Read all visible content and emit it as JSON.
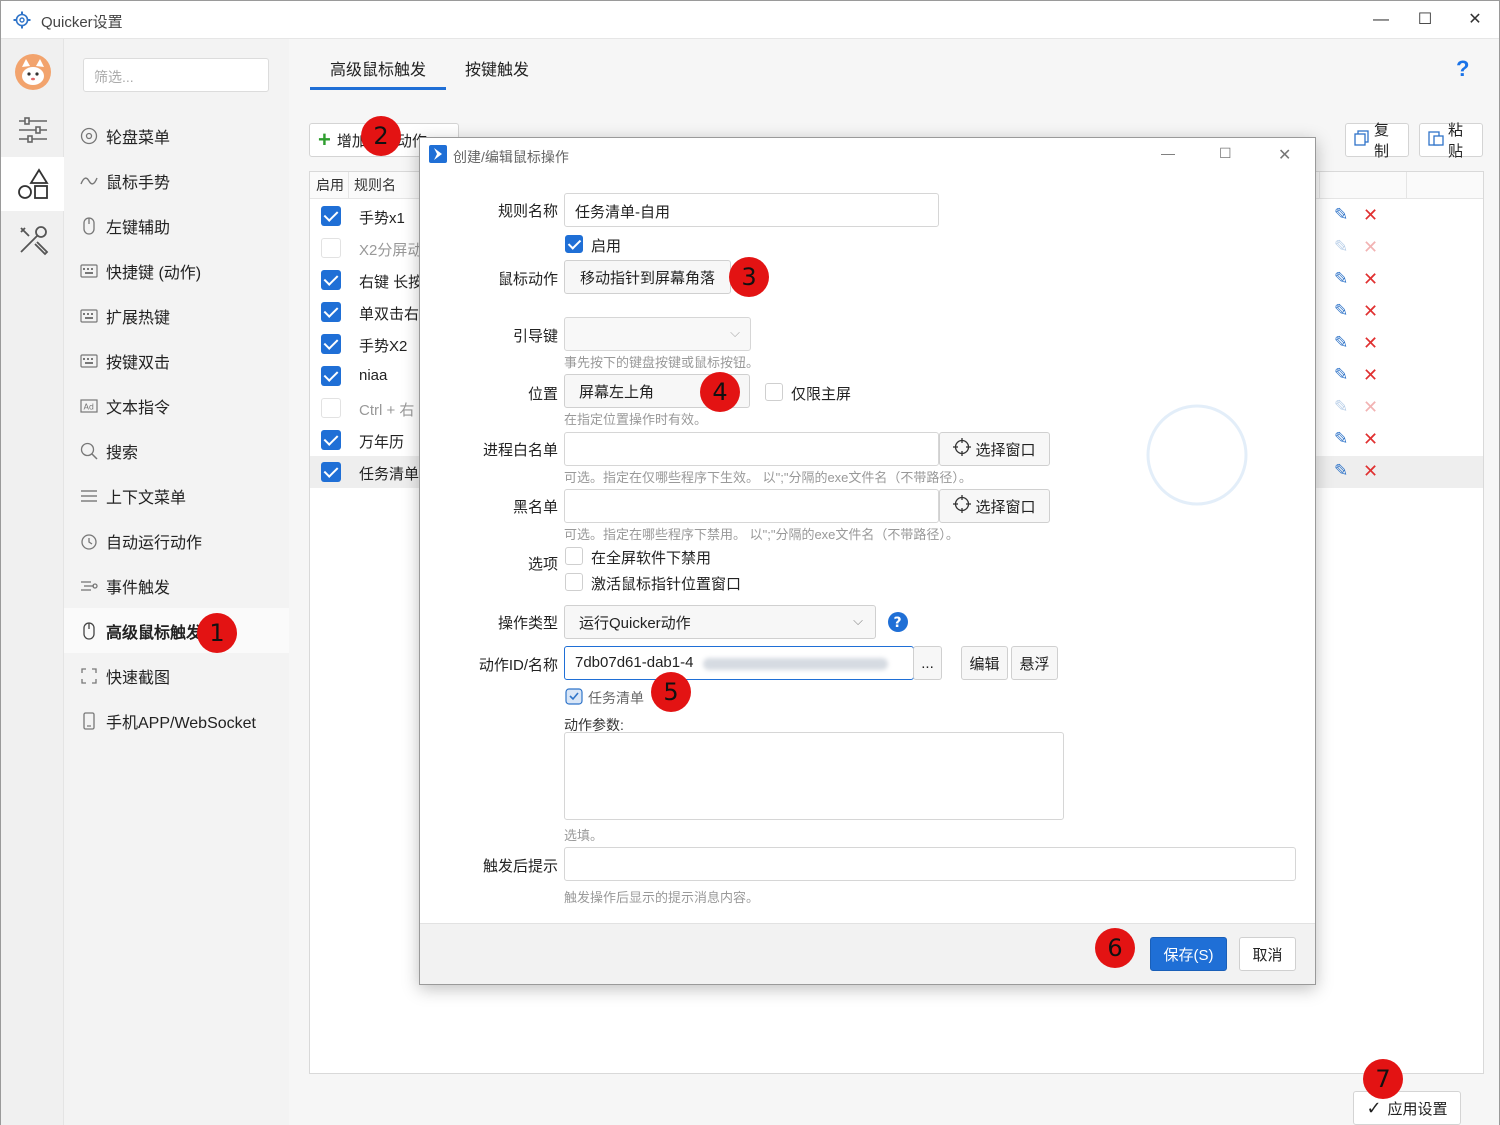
{
  "window": {
    "title": "Quicker设置",
    "minimize": "—",
    "maximize": "☐",
    "close": "✕"
  },
  "rail": {
    "icons": [
      "avatar",
      "sliders-icon",
      "shapes-icon",
      "tools-icon"
    ]
  },
  "nav": {
    "filter_placeholder": "筛选...",
    "items": [
      {
        "label": "轮盘菜单",
        "icon": "wheel-icon"
      },
      {
        "label": "鼠标手势",
        "icon": "gesture-icon"
      },
      {
        "label": "左键辅助",
        "icon": "mouse-icon"
      },
      {
        "label": "快捷键 (动作)",
        "icon": "keyboard-icon"
      },
      {
        "label": "扩展热键",
        "icon": "keyboard-icon"
      },
      {
        "label": "按键双击",
        "icon": "keyboard-icon"
      },
      {
        "label": "文本指令",
        "icon": "ad-icon"
      },
      {
        "label": "搜索",
        "icon": "search-icon"
      },
      {
        "label": "上下文菜单",
        "icon": "menu-icon"
      },
      {
        "label": "自动运行动作",
        "icon": "clock-icon"
      },
      {
        "label": "事件触发",
        "icon": "event-icon"
      },
      {
        "label": "高级鼠标触发",
        "icon": "mouse-icon"
      },
      {
        "label": "快速截图",
        "icon": "crop-icon"
      },
      {
        "label": "手机APP/WebSocket",
        "icon": "phone-icon"
      }
    ],
    "active_index": 11
  },
  "tabs": [
    {
      "label": "高级鼠标触发"
    },
    {
      "label": "按键触发"
    }
  ],
  "help": "?",
  "toolbar": {
    "add_label": "增加鼠标动作",
    "copy_label": "复制",
    "paste_label": "粘贴"
  },
  "table": {
    "headers": {
      "enabled": "启用",
      "name": "规则名"
    },
    "rows": [
      {
        "enabled": true,
        "name": "手势x1"
      },
      {
        "enabled": false,
        "name": "X2分屏动"
      },
      {
        "enabled": true,
        "name": "右键 长按"
      },
      {
        "enabled": true,
        "name": "单双击右"
      },
      {
        "enabled": true,
        "name": "手势X2"
      },
      {
        "enabled": true,
        "name": "niaa"
      },
      {
        "enabled": false,
        "name": "Ctrl + 右"
      },
      {
        "enabled": true,
        "name": "万年历"
      },
      {
        "enabled": true,
        "name": "任务清单"
      }
    ]
  },
  "apply_label": "应用设置",
  "dialog": {
    "title": "创建/编辑鼠标操作",
    "rule_name_label": "规则名称",
    "rule_name_value": "任务清单-自用",
    "enabled_label": "启用",
    "mouse_action_label": "鼠标动作",
    "mouse_action_value": "移动指针到屏幕角落",
    "lead_key_label": "引导键",
    "lead_key_hint": "事先按下的键盘按键或鼠标按钮。",
    "position_label": "位置",
    "position_value": "屏幕左上角",
    "main_screen_only_label": "仅限主屏",
    "position_hint": "在指定位置操作时有效。",
    "whitelist_label": "进程白名单",
    "whitelist_hint": "可选。指定在仅哪些程序下生效。 以\";\"分隔的exe文件名（不带路径）。",
    "select_window_label": "选择窗口",
    "blacklist_label": "黑名单",
    "blacklist_hint": "可选。指定在哪些程序下禁用。 以\";\"分隔的exe文件名（不带路径）。",
    "options_label": "选项",
    "option_fullscreen_label": "在全屏软件下禁用",
    "option_activate_label": "激活鼠标指针位置窗口",
    "op_type_label": "操作类型",
    "op_type_value": "运行Quicker动作",
    "action_id_label": "动作ID/名称",
    "action_id_value": "7db07d61-dab1-4",
    "more_label": "...",
    "edit_label": "编辑",
    "float_label": "悬浮",
    "action_name_value": "任务清单",
    "params_label": "动作参数:",
    "params_hint": "选填。",
    "trigger_tip_label": "触发后提示",
    "trigger_tip_hint": "触发操作后显示的提示消息内容。",
    "save_label": "保存(S)",
    "cancel_label": "取消"
  },
  "badges": [
    "1",
    "2",
    "3",
    "4",
    "5",
    "6",
    "7"
  ],
  "colors": {
    "accent": "#1f6fd6",
    "badge": "#e31313",
    "delete": "#e03030",
    "add": "#2e9d2e"
  }
}
